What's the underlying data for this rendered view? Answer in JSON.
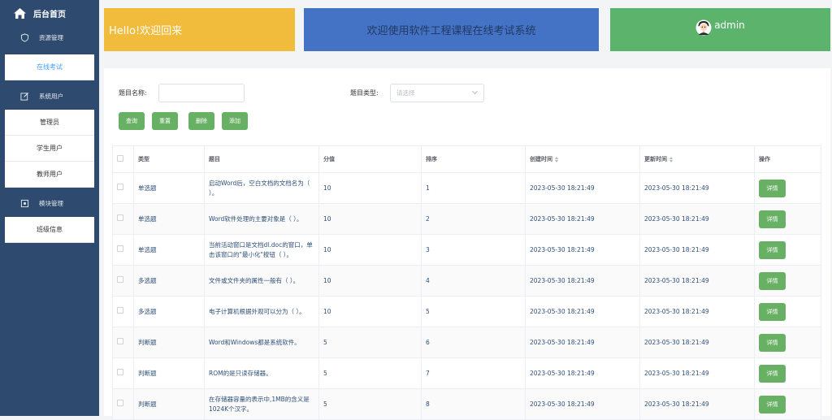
{
  "sidebar": {
    "home_label": "后台首页",
    "groups": [
      {
        "label": "资源管理",
        "icon": "shield-icon",
        "items": [
          {
            "label": "在线考试",
            "active": true
          }
        ]
      },
      {
        "label": "系统用户",
        "icon": "edit-icon",
        "items": [
          {
            "label": "管理员"
          },
          {
            "label": "学生用户"
          },
          {
            "label": "教师用户"
          }
        ]
      },
      {
        "label": "模块管理",
        "icon": "module-icon",
        "items": [
          {
            "label": "班级信息"
          }
        ]
      }
    ]
  },
  "cards": {
    "welcome": "Hello!欢迎回来",
    "system_title": "欢迎使用软件工程课程在线考试系统",
    "user": "admin"
  },
  "search": {
    "name_label": "题目名称:",
    "name_value": "",
    "type_label": "题目类型:",
    "type_placeholder": "请选择",
    "buttons": {
      "query": "查询",
      "reset": "重置",
      "delete": "删除",
      "add": "添加"
    }
  },
  "table": {
    "headers": {
      "type": "类型",
      "question": "题目",
      "score": "分值",
      "order": "排序",
      "created": "创建时间",
      "updated": "更新时间",
      "action": "操作"
    },
    "rows": [
      {
        "type": "单选题",
        "question": "启动Word后，空白文档的文档名为（ ）。",
        "score": "10",
        "order": "1",
        "created": "2023-05-30 18:21:49",
        "updated": "2023-05-30 18:21:49",
        "action": "详情"
      },
      {
        "type": "单选题",
        "question": "Word软件处理的主要对象是（ ）。",
        "score": "10",
        "order": "2",
        "created": "2023-05-30 18:21:49",
        "updated": "2023-05-30 18:21:49",
        "action": "详情"
      },
      {
        "type": "单选题",
        "question": "当前活动窗口是文档dl.doc的窗口，单击该窗口的\"最小化\"按钮（ ）。",
        "score": "10",
        "order": "3",
        "created": "2023-05-30 18:21:49",
        "updated": "2023-05-30 18:21:49",
        "action": "详情"
      },
      {
        "type": "多选题",
        "question": "文件或文件夹的属性一般有（ ）。",
        "score": "10",
        "order": "4",
        "created": "2023-05-30 18:21:49",
        "updated": "2023-05-30 18:21:49",
        "action": "详情"
      },
      {
        "type": "多选题",
        "question": "电子计算机根据外观可以分为（ ）。",
        "score": "10",
        "order": "5",
        "created": "2023-05-30 18:21:49",
        "updated": "2023-05-30 18:21:49",
        "action": "详情"
      },
      {
        "type": "判断题",
        "question": "Word和Windows都是系统软件。",
        "score": "5",
        "order": "6",
        "created": "2023-05-30 18:21:49",
        "updated": "2023-05-30 18:21:49",
        "action": "详情"
      },
      {
        "type": "判断题",
        "question": "ROM的是只读存储器。",
        "score": "5",
        "order": "7",
        "created": "2023-05-30 18:21:49",
        "updated": "2023-05-30 18:21:49",
        "action": "详情"
      },
      {
        "type": "判断题",
        "question": "在存储器容量的表示中,1MB的含义是1024K个汉字。",
        "score": "5",
        "order": "8",
        "created": "2023-05-30 18:21:49",
        "updated": "2023-05-30 18:21:49",
        "action": "详情"
      }
    ]
  },
  "colors": {
    "sidebar": "#2e4a6e",
    "welcome": "#f1bb3c",
    "title_card": "#4472c4",
    "user_card": "#5cb36c",
    "button": "#67b064",
    "active": "#409eff"
  }
}
